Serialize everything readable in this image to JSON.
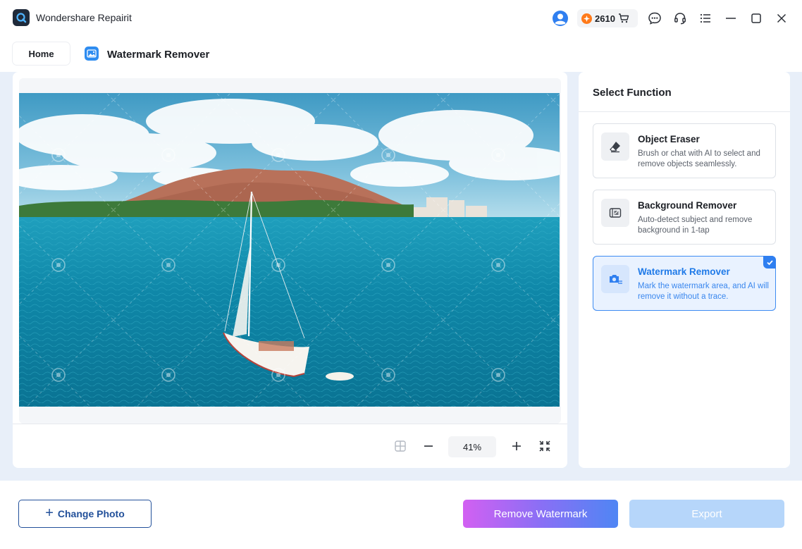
{
  "app": {
    "title": "Wondershare Repairit",
    "credits": "2610"
  },
  "titlebar": {
    "icons": [
      "user-avatar-icon",
      "coin-icon",
      "cart-icon",
      "chat-icon",
      "headset-icon",
      "menu-list-icon",
      "minimize-icon",
      "maximize-icon",
      "close-icon"
    ]
  },
  "tabs": {
    "home_label": "Home",
    "page_title": "Watermark Remover"
  },
  "zoom": {
    "value": "41%"
  },
  "functions": {
    "title": "Select Function",
    "items": [
      {
        "name": "Object Eraser",
        "desc": "Brush or chat with AI to select and remove objects seamlessly.",
        "icon": "eraser-icon"
      },
      {
        "name": "Background Remover",
        "desc": "Auto-detect subject and remove background in 1-tap",
        "icon": "background-remove-icon"
      },
      {
        "name": "Watermark Remover",
        "desc": "Mark the watermark area, and AI will remove it without a trace.",
        "icon": "watermark-remove-icon",
        "selected": true
      }
    ]
  },
  "bottom": {
    "change_photo": "Change Photo",
    "remove_watermark": "Remove Watermark",
    "export": "Export"
  },
  "colors": {
    "accent": "#2f7ff0",
    "main_bg": "#e8eff9",
    "button_outline": "#22509a",
    "export_disabled": "#b6d6fa"
  }
}
